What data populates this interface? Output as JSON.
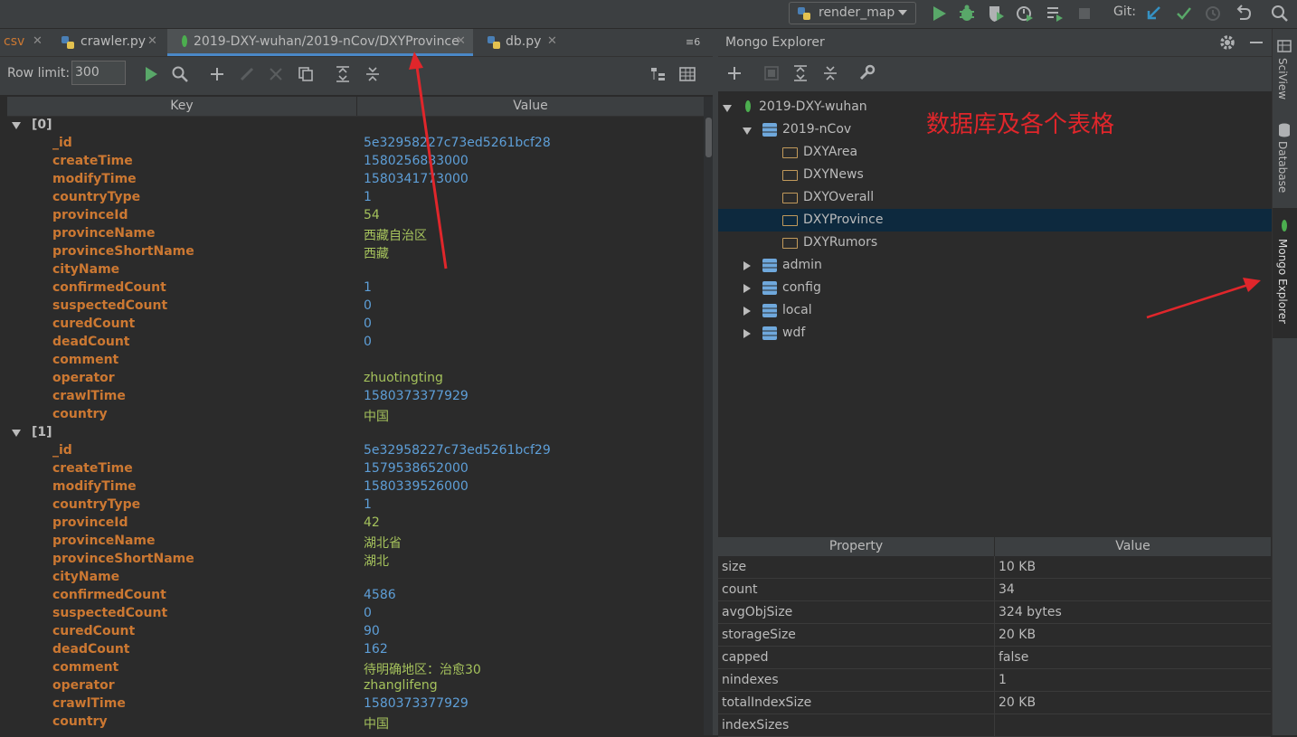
{
  "toolbar": {
    "run_config": "render_map",
    "git_label": "Git:"
  },
  "tabs": [
    {
      "label": "csv",
      "active": false
    },
    {
      "label": "crawler.py",
      "active": false
    },
    {
      "label": "2019-DXY-wuhan/2019-nCov/DXYProvince",
      "active": true
    },
    {
      "label": "db.py",
      "active": false
    }
  ],
  "tab_overflow": "≡6",
  "data_toolbar": {
    "row_limit_label": "Row limit:",
    "row_limit_value": "300"
  },
  "table": {
    "headers": {
      "key": "Key",
      "value": "Value"
    },
    "records": [
      {
        "index": "[0]",
        "fields": [
          {
            "key": "_id",
            "value": "5e32958227c73ed5261bcf28",
            "type": "blue"
          },
          {
            "key": "createTime",
            "value": "1580256883000",
            "type": "blue"
          },
          {
            "key": "modifyTime",
            "value": "1580341773000",
            "type": "blue"
          },
          {
            "key": "countryType",
            "value": "1",
            "type": "blue"
          },
          {
            "key": "provinceId",
            "value": "54",
            "type": "green"
          },
          {
            "key": "provinceName",
            "value": "西藏自治区",
            "type": "green"
          },
          {
            "key": "provinceShortName",
            "value": "西藏",
            "type": "green"
          },
          {
            "key": "cityName",
            "value": "",
            "type": "green"
          },
          {
            "key": "confirmedCount",
            "value": "1",
            "type": "blue"
          },
          {
            "key": "suspectedCount",
            "value": "0",
            "type": "blue"
          },
          {
            "key": "curedCount",
            "value": "0",
            "type": "blue"
          },
          {
            "key": "deadCount",
            "value": "0",
            "type": "blue"
          },
          {
            "key": "comment",
            "value": "",
            "type": "green"
          },
          {
            "key": "operator",
            "value": "zhuotingting",
            "type": "green"
          },
          {
            "key": "crawlTime",
            "value": "1580373377929",
            "type": "blue"
          },
          {
            "key": "country",
            "value": "中国",
            "type": "green"
          }
        ]
      },
      {
        "index": "[1]",
        "fields": [
          {
            "key": "_id",
            "value": "5e32958227c73ed5261bcf29",
            "type": "blue"
          },
          {
            "key": "createTime",
            "value": "1579538652000",
            "type": "blue"
          },
          {
            "key": "modifyTime",
            "value": "1580339526000",
            "type": "blue"
          },
          {
            "key": "countryType",
            "value": "1",
            "type": "blue"
          },
          {
            "key": "provinceId",
            "value": "42",
            "type": "green"
          },
          {
            "key": "provinceName",
            "value": "湖北省",
            "type": "green"
          },
          {
            "key": "provinceShortName",
            "value": "湖北",
            "type": "green"
          },
          {
            "key": "cityName",
            "value": "",
            "type": "green"
          },
          {
            "key": "confirmedCount",
            "value": "4586",
            "type": "blue"
          },
          {
            "key": "suspectedCount",
            "value": "0",
            "type": "blue"
          },
          {
            "key": "curedCount",
            "value": "90",
            "type": "blue"
          },
          {
            "key": "deadCount",
            "value": "162",
            "type": "blue"
          },
          {
            "key": "comment",
            "value": "待明确地区：治愈30",
            "type": "green"
          },
          {
            "key": "operator",
            "value": "zhanglifeng",
            "type": "green"
          },
          {
            "key": "crawlTime",
            "value": "1580373377929",
            "type": "blue"
          },
          {
            "key": "country",
            "value": "中国",
            "type": "green"
          }
        ]
      }
    ]
  },
  "mongo_explorer": {
    "title": "Mongo Explorer",
    "server": "2019-DXY-wuhan",
    "database": "2019-nCov",
    "collections": [
      "DXYArea",
      "DXYNews",
      "DXYOverall",
      "DXYProvince",
      "DXYRumors"
    ],
    "selected_collection": "DXYProvince",
    "other_databases": [
      "admin",
      "config",
      "local",
      "wdf"
    ],
    "annotation": "数据库及各个表格"
  },
  "properties": {
    "headers": {
      "property": "Property",
      "value": "Value"
    },
    "rows": [
      {
        "property": "size",
        "value": "10 KB"
      },
      {
        "property": "count",
        "value": "34"
      },
      {
        "property": "avgObjSize",
        "value": "324 bytes"
      },
      {
        "property": "storageSize",
        "value": "20 KB"
      },
      {
        "property": "capped",
        "value": "false"
      },
      {
        "property": "nindexes",
        "value": "1"
      },
      {
        "property": "totalIndexSize",
        "value": "20 KB"
      },
      {
        "property": "indexSizes",
        "value": ""
      }
    ]
  },
  "side_tabs": [
    "SciView",
    "Database",
    "Mongo Explorer"
  ],
  "colors": {
    "background": "#2b2b2b",
    "panel": "#3c3f41",
    "key": "#cc7832",
    "number": "#5e9fd8",
    "string": "#a5c25c",
    "selection": "#0d293e",
    "annotation": "#e0262b"
  }
}
